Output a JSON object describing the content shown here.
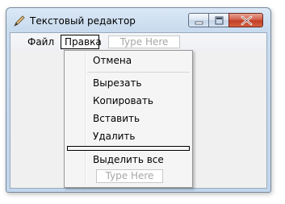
{
  "window": {
    "title": "Текстовый редактор",
    "app_icon": "pen-icon",
    "controls": [
      "minimize-icon",
      "maximize-icon",
      "close-icon"
    ]
  },
  "menubar": {
    "items": [
      {
        "label": "Файл"
      },
      {
        "label": "Правка",
        "state": "open"
      }
    ],
    "placeholder": "Type Here"
  },
  "dropdown": {
    "items": [
      {
        "label": "Отмена"
      },
      {
        "label": "Вырезать"
      },
      {
        "label": "Копировать"
      },
      {
        "label": "Вставить"
      },
      {
        "label": "Удалить"
      },
      {
        "label": "Выделить все"
      }
    ],
    "placeholder": "Type Here"
  },
  "colors": {
    "frame": "#c9dcef",
    "close_button": "#c23e24",
    "client_bg": "#f0f0f0",
    "menu_bg": "#f5f5f5"
  }
}
